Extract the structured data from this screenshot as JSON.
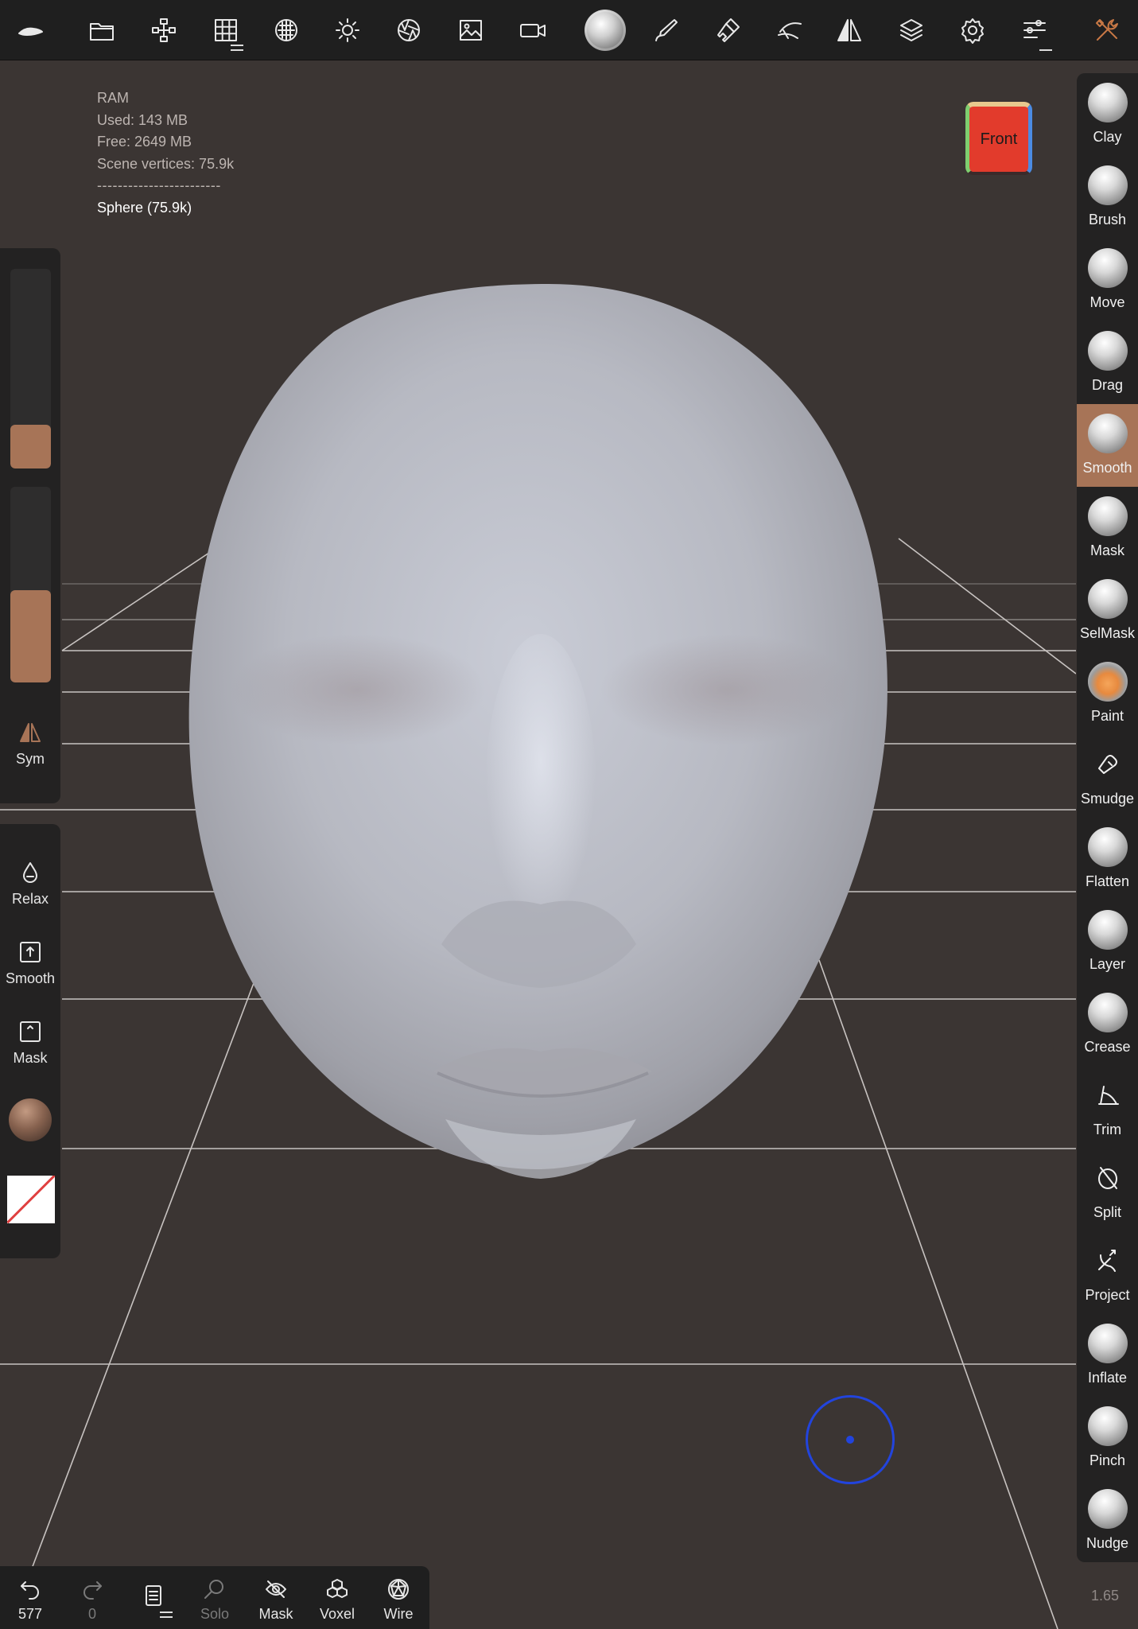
{
  "toolbar": {
    "icons": [
      "nomad-logo-icon",
      "folder-icon",
      "scene-tree-icon",
      "grid-menu-icon",
      "topology-icon",
      "light-icon",
      "shading-icon",
      "background-image-icon",
      "camera-icon",
      "active-tool-icon",
      "stroke-icon",
      "brush-settings-icon",
      "painting-icon",
      "symmetry-icon",
      "layers-icon",
      "settings-icon",
      "sliders-menu-icon",
      "tools-icon"
    ]
  },
  "stats": {
    "ram_label": "RAM",
    "used": "Used: 143 MB",
    "free": "Free: 2649 MB",
    "vertices": "Scene vertices: 75.9k",
    "separator": "------------------------",
    "mesh": "Sphere (75.9k)"
  },
  "view_cube": {
    "label": "Front",
    "color": "#e23b2c"
  },
  "left_panel": {
    "radius_level": 0.22,
    "intensity_level": 0.47,
    "sym_label": "Sym",
    "relax_label": "Relax",
    "smooth_label": "Smooth",
    "mask_label": "Mask"
  },
  "accent_color": "#a77457",
  "tools": [
    {
      "label": "Clay",
      "kind": "ball"
    },
    {
      "label": "Brush",
      "kind": "ball"
    },
    {
      "label": "Move",
      "kind": "ball"
    },
    {
      "label": "Drag",
      "kind": "ball"
    },
    {
      "label": "Smooth",
      "kind": "ball",
      "active": true
    },
    {
      "label": "Mask",
      "kind": "ball"
    },
    {
      "label": "SelMask",
      "kind": "ball"
    },
    {
      "label": "Paint",
      "kind": "paint"
    },
    {
      "label": "Smudge",
      "kind": "icon"
    },
    {
      "label": "Flatten",
      "kind": "ball"
    },
    {
      "label": "Layer",
      "kind": "ball"
    },
    {
      "label": "Crease",
      "kind": "ball"
    },
    {
      "label": "Trim",
      "kind": "icon"
    },
    {
      "label": "Split",
      "kind": "icon"
    },
    {
      "label": "Project",
      "kind": "icon"
    },
    {
      "label": "Inflate",
      "kind": "ball"
    },
    {
      "label": "Pinch",
      "kind": "ball"
    },
    {
      "label": "Nudge",
      "kind": "ball"
    }
  ],
  "bottom": {
    "undo_count": "577",
    "redo_count": "0",
    "solo_label": "Solo",
    "mask_label": "Mask",
    "voxel_label": "Voxel",
    "wire_label": "Wire"
  },
  "zoom": "1.65"
}
